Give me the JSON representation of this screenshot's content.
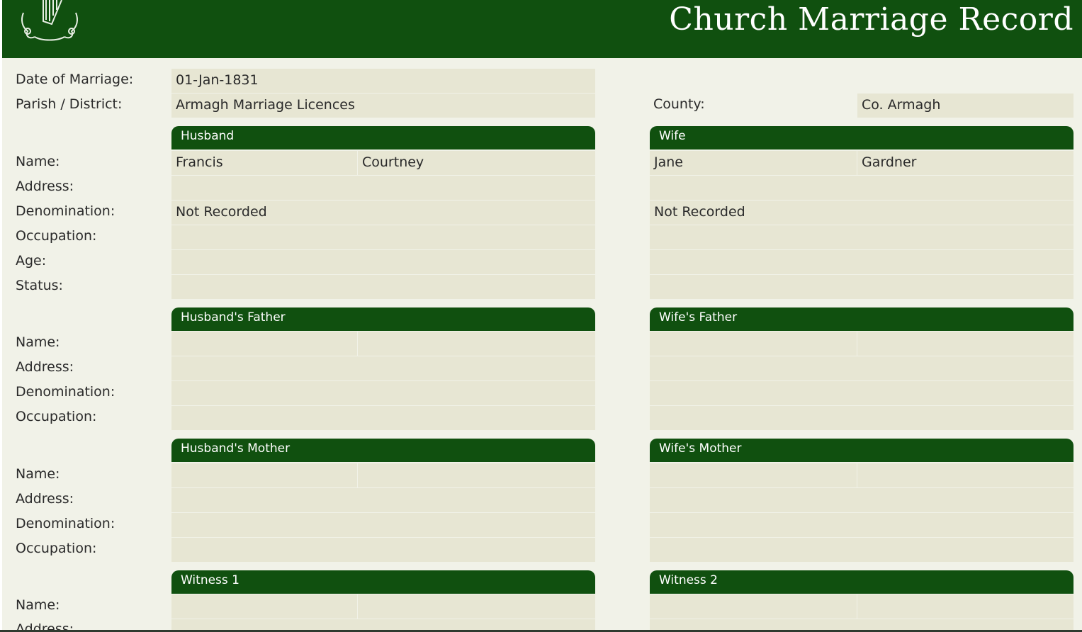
{
  "header": {
    "title": "Church Marriage Record",
    "logo_icon": "harp-emblem-icon"
  },
  "general": {
    "date_label": "Date of Marriage:",
    "date_value": "01-Jan-1831",
    "parish_label": "Parish / District:",
    "parish_value": "Armagh Marriage Licences",
    "county_label": "County:",
    "county_value": "Co. Armagh"
  },
  "labels": {
    "name": "Name:",
    "address": "Address:",
    "denomination": "Denomination:",
    "occupation": "Occupation:",
    "age": "Age:",
    "status": "Status:",
    "address_partial": "Address:"
  },
  "sections": {
    "husband": {
      "title": "Husband",
      "first_name": "Francis",
      "surname": "Courtney",
      "address": "",
      "denomination": "Not Recorded",
      "occupation": "",
      "age": "",
      "status": ""
    },
    "wife": {
      "title": "Wife",
      "first_name": "Jane",
      "surname": "Gardner",
      "address": "",
      "denomination": "Not Recorded",
      "occupation": "",
      "age": "",
      "status": ""
    },
    "husbands_father": {
      "title": "Husband's Father"
    },
    "wifes_father": {
      "title": "Wife's Father"
    },
    "husbands_mother": {
      "title": "Husband's Mother"
    },
    "wifes_mother": {
      "title": "Wife's Mother"
    },
    "witness1": {
      "title": "Witness 1"
    },
    "witness2": {
      "title": "Witness 2"
    }
  },
  "colors": {
    "header_green": "#10500f",
    "field_bg": "#e7e6d3",
    "page_bg": "#f1f2e8"
  }
}
